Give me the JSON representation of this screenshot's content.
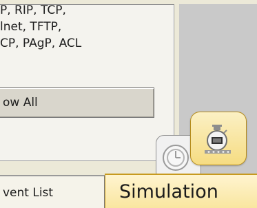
{
  "filters": {
    "protocol_lines": [
      "P, RIP, TCP,",
      "lnet, TFTP,",
      "CP, PAgP, ACL"
    ]
  },
  "show_all_button": {
    "label": "ow All"
  },
  "mode_tabs": {
    "event_list_label": "vent List",
    "simulation_label": "Simulation",
    "realtime_icon": "clock-icon",
    "simulation_icon": "stopwatch-icon"
  },
  "colors": {
    "simulation_accent": "#f6dc82",
    "panel_background": "#f4f3ee",
    "right_area": "#c9c9c9"
  }
}
